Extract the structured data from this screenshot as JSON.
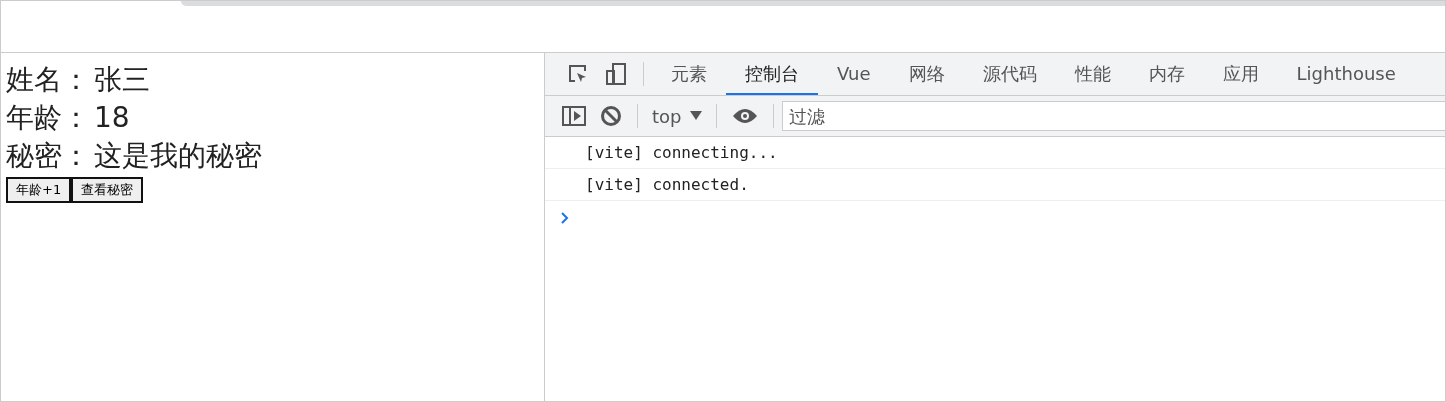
{
  "page": {
    "fields": [
      {
        "label": "姓名：",
        "value": "张三"
      },
      {
        "label": "年龄：",
        "value": "18"
      },
      {
        "label": "秘密：",
        "value": "这是我的秘密"
      }
    ],
    "buttons": [
      "年龄+1",
      "查看秘密"
    ]
  },
  "devtools": {
    "tabs": [
      {
        "label": "元素",
        "selected": false
      },
      {
        "label": "控制台",
        "selected": true
      },
      {
        "label": "Vue",
        "selected": false
      },
      {
        "label": "网络",
        "selected": false
      },
      {
        "label": "源代码",
        "selected": false
      },
      {
        "label": "性能",
        "selected": false
      },
      {
        "label": "内存",
        "selected": false
      },
      {
        "label": "应用",
        "selected": false
      },
      {
        "label": "Lighthouse",
        "selected": false
      }
    ],
    "context": "top",
    "filter": {
      "placeholder": "过滤"
    },
    "messages": [
      "[vite] connecting...",
      "[vite] connected."
    ]
  }
}
